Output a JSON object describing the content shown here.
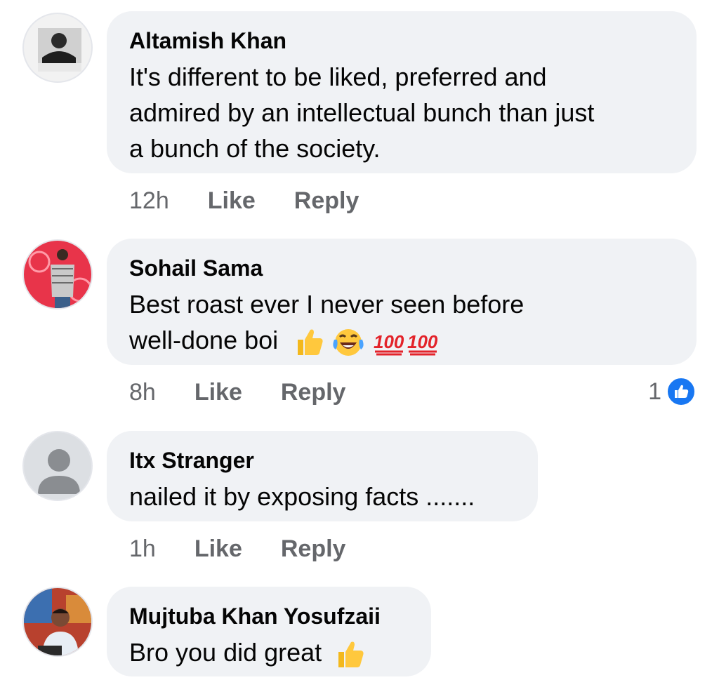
{
  "comments": [
    {
      "author": "Altamish Khan",
      "lines": [
        "It's different to be liked, preferred and",
        "admired by an intellectual bunch than just",
        "a bunch of the society."
      ],
      "time": "12h",
      "like_label": "Like",
      "reply_label": "Reply"
    },
    {
      "author": "Sohail Sama",
      "lines": [
        "Best roast ever I never seen before",
        "well-done boi"
      ],
      "emojis": [
        "thumbs-up",
        "tears-of-joy",
        "hundred-points",
        "hundred-points"
      ],
      "time": "8h",
      "like_label": "Like",
      "reply_label": "Reply",
      "reaction_count": "1",
      "reaction_type": "like"
    },
    {
      "author": "Itx Stranger",
      "lines": [
        "nailed it by exposing facts ......."
      ],
      "time": "1h",
      "like_label": "Like",
      "reply_label": "Reply"
    },
    {
      "author": "Mujtuba Khan Yosufzaii",
      "lines": [
        "Bro you did great"
      ],
      "emojis": [
        "thumbs-up"
      ]
    }
  ],
  "colors": {
    "bubble": "#f0f2f5",
    "meta_text": "#65676b",
    "like_badge": "#1877f2"
  }
}
